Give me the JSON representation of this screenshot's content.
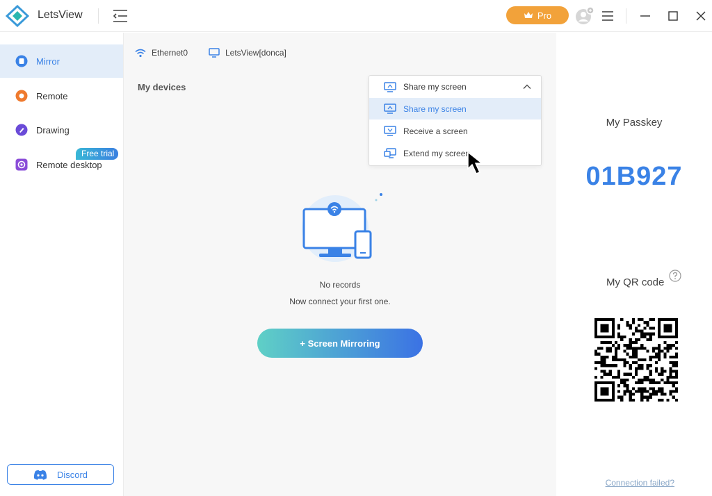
{
  "titlebar": {
    "app_name": "LetsView",
    "pro_label": "Pro"
  },
  "sidebar": {
    "items": [
      {
        "label": "Mirror",
        "active": true
      },
      {
        "label": "Remote",
        "active": false
      },
      {
        "label": "Drawing",
        "active": false
      },
      {
        "label": "Remote desktop",
        "active": false
      }
    ],
    "free_trial_badge": "Free trial",
    "discord_label": "Discord"
  },
  "main": {
    "network_name": "Ethernet0",
    "device_name": "LetsView[donca]",
    "section_title": "My devices",
    "dropdown": {
      "selected": "Share my screen",
      "options": [
        "Share my screen",
        "Receive a screen",
        "Extend my screen"
      ]
    },
    "empty_title": "No records",
    "empty_subtitle": "Now connect your first one.",
    "mirror_button": "+ Screen Mirroring"
  },
  "rightpanel": {
    "passkey_title": "My Passkey",
    "passkey_value": "01B927",
    "qr_title": "My QR code",
    "connection_failed": "Connection failed?"
  },
  "colors": {
    "accent": "#3a82e6",
    "pro": "#f2a23a",
    "active_bg": "#e3edf9"
  }
}
